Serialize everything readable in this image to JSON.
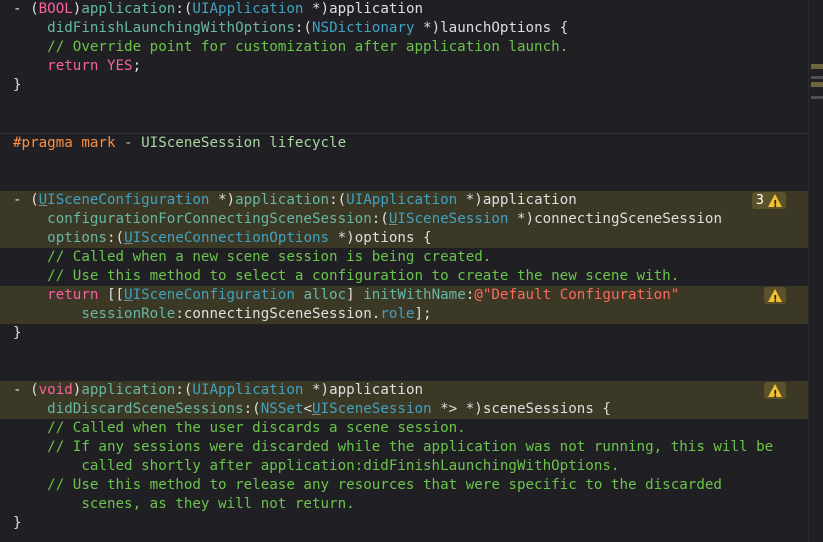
{
  "code": {
    "l1": {
      "a": "- (",
      "b": "BOOL",
      "c": ")",
      "d": "application",
      "e": ":(",
      "f": "UIApplication",
      "g": " *)application"
    },
    "l2": {
      "a": "    ",
      "b": "didFinishLaunchingWithOptions",
      "c": ":(",
      "d": "NSDictionary",
      "e": " *)launchOptions {"
    },
    "l3": {
      "a": "    ",
      "b": "// Override point for customization after application launch."
    },
    "l4": {
      "a": "    ",
      "b": "return",
      "c": " ",
      "d": "YES",
      "e": ";"
    },
    "l5": "}",
    "pragma": {
      "a": "#pragma mark",
      "b": " - UISceneSession lifecycle"
    },
    "l6": {
      "a": "- (",
      "b": "U",
      "c": "ISceneConfiguration",
      "d": " *)",
      "e": "application",
      "f": ":(",
      "g": "UIApplication",
      "h": " *)application"
    },
    "l7": {
      "a": "    ",
      "b": "configurationForConnectingSceneSession",
      "c": ":(",
      "d": "U",
      "e": "ISceneSession",
      "f": " *)connectingSceneSession"
    },
    "l8": {
      "a": "    ",
      "b": "options",
      "c": ":(",
      "d": "U",
      "e": "ISceneConnectionOptions",
      "f": " *)options {"
    },
    "l9": {
      "a": "    ",
      "b": "// Called when a new scene session is being created."
    },
    "l10": {
      "a": "    ",
      "b": "// Use this method to select a configuration to create the new scene with."
    },
    "l11": {
      "a": "    ",
      "b": "return",
      "c": " [[",
      "d": "U",
      "e": "ISceneConfiguration",
      "f": " ",
      "g": "alloc",
      "h": "] ",
      "i": "initWithName",
      "j": ":",
      "k": "@\"Default Configuration\""
    },
    "l12": {
      "a": "        ",
      "b": "sessionRole",
      "c": ":connectingSceneSession.",
      "d": "role",
      "e": "];"
    },
    "l13": "}",
    "l14": {
      "a": "- (",
      "b": "void",
      "c": ")",
      "d": "application",
      "e": ":(",
      "f": "UIApplication",
      "g": " *)application"
    },
    "l15": {
      "a": "    ",
      "b": "didDiscardSceneSessions",
      "c": ":(",
      "d": "NSSet",
      "e": "<",
      "f": "U",
      "g": "ISceneSession",
      "h": " *> *)sceneSessions {"
    },
    "l16": {
      "a": "    ",
      "b": "// Called when the user discards a scene session."
    },
    "l17": {
      "a": "    ",
      "b": "// If any sessions were discarded while the application was not running, this will be"
    },
    "l18": {
      "a": "        ",
      "b": "called shortly after application:didFinishLaunchingWithOptions."
    },
    "l19": {
      "a": "    ",
      "b": "// Use this method to release any resources that were specific to the discarded"
    },
    "l20": {
      "a": "        ",
      "b": "scenes, as they will not return."
    },
    "l21": "}"
  },
  "badges": {
    "b1": {
      "count": "3",
      "icon": "warning-icon"
    },
    "b2": {
      "icon": "warning-icon"
    },
    "b3": {
      "icon": "warning-icon"
    }
  },
  "colors": {
    "background": "#1f1f24",
    "keyword": "#fc5fa3",
    "type": "#5dd8ff",
    "class": "#41a1c0",
    "method": "#67b7a4",
    "comment": "#6bc44b",
    "string": "#fc6a5d",
    "warning": "#f2c12e"
  }
}
